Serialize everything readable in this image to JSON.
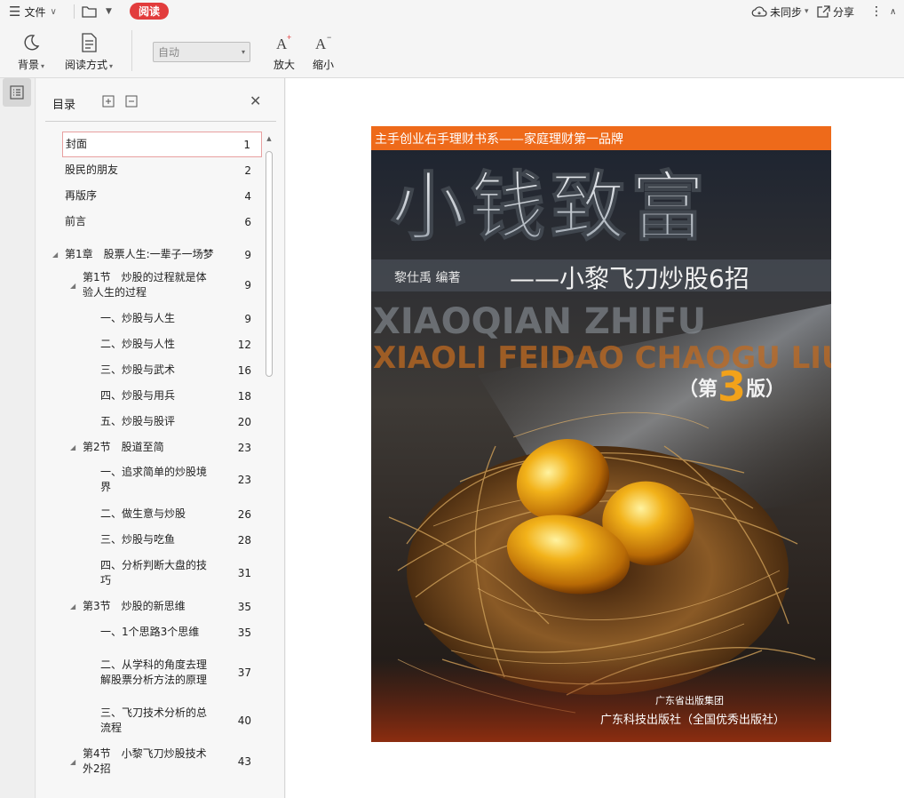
{
  "titlebar": {
    "menu_label": "文件",
    "read_label": "阅读",
    "sync_label": "未同步",
    "share_label": "分享"
  },
  "toolbar": {
    "background_label": "背景",
    "read_mode_label": "阅读方式",
    "zoom_value": "自动",
    "zoom_in_label": "放大",
    "zoom_out_label": "缩小"
  },
  "toc": {
    "title": "目录",
    "items": [
      {
        "label": "封面",
        "page": "1"
      },
      {
        "label": "股民的朋友",
        "page": "2"
      },
      {
        "label": "再版序",
        "page": "4"
      },
      {
        "label": "前言",
        "page": "6"
      },
      {
        "label": "第1章　股票人生:一辈子一场梦",
        "page": "9"
      },
      {
        "label": "第1节　炒股的过程就是体验人生的过程",
        "page": "9"
      },
      {
        "label": "一、炒股与人生",
        "page": "9"
      },
      {
        "label": "二、炒股与人性",
        "page": "12"
      },
      {
        "label": "三、炒股与武术",
        "page": "16"
      },
      {
        "label": "四、炒股与用兵",
        "page": "18"
      },
      {
        "label": "五、炒股与股评",
        "page": "20"
      },
      {
        "label": "第2节　股道至简",
        "page": "23"
      },
      {
        "label": "一、追求简单的炒股境界",
        "page": "23"
      },
      {
        "label": "二、做生意与炒股",
        "page": "26"
      },
      {
        "label": "三、炒股与吃鱼",
        "page": "28"
      },
      {
        "label": "四、分析判断大盘的技巧",
        "page": "31"
      },
      {
        "label": "第3节　炒股的新思维",
        "page": "35"
      },
      {
        "label": "一、1个思路3个思维",
        "page": "35"
      },
      {
        "label": "二、从学科的角度去理解股票分析方法的原理",
        "page": "37"
      },
      {
        "label": "三、飞刀技术分析的总流程",
        "page": "40"
      },
      {
        "label": "第4节　小黎飞刀炒股技术外2招",
        "page": "43"
      }
    ]
  },
  "cover": {
    "series_line": "主手创业右手理财书系——家庭理财第一品牌",
    "main_title": "小钱致富",
    "author": "黎仕禹  编著",
    "subtitle": "——小黎飞刀炒股6招",
    "pinyin_1": "XIAOQIAN ZHIFU",
    "pinyin_2": "XIAOLI FEIDAO CHAOGU LIUZHAO",
    "edition_open": "（第",
    "edition_num": "3",
    "edition_close": "版）",
    "publisher_group": "广东省出版集团",
    "publisher": "广东科技出版社（全国优秀出版社）"
  }
}
